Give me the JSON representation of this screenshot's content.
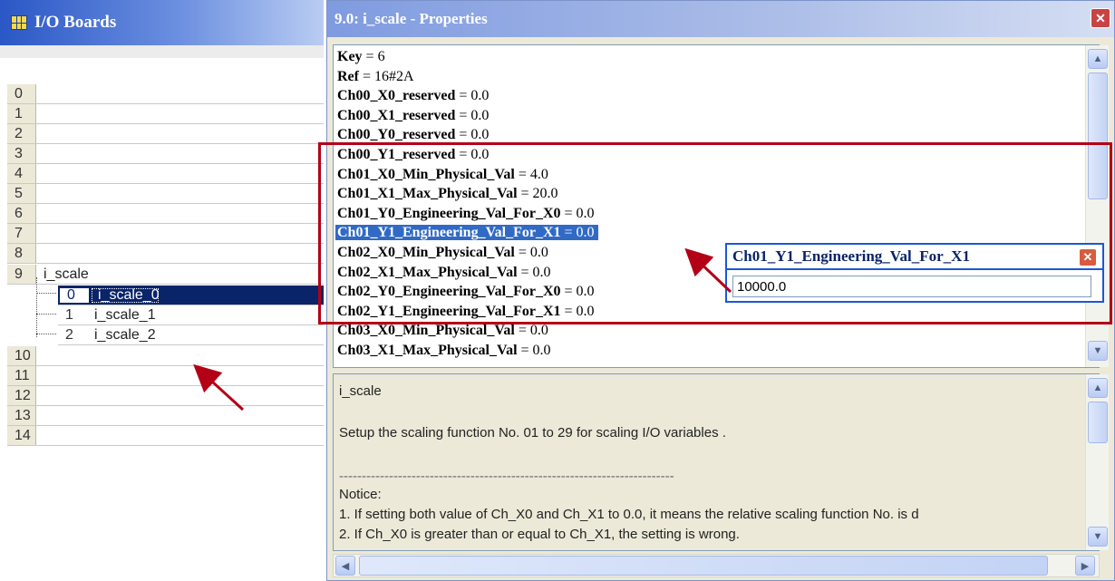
{
  "left_panel": {
    "title": "I/O Boards",
    "rows": [
      {
        "num": "0",
        "label": ""
      },
      {
        "num": "1",
        "label": ""
      },
      {
        "num": "2",
        "label": ""
      },
      {
        "num": "3",
        "label": ""
      },
      {
        "num": "4",
        "label": ""
      },
      {
        "num": "5",
        "label": ""
      },
      {
        "num": "6",
        "label": ""
      },
      {
        "num": "7",
        "label": ""
      },
      {
        "num": "8",
        "label": ""
      },
      {
        "num": "9",
        "label": "i_scale"
      },
      {
        "num": "0",
        "label": "i_scale_0"
      },
      {
        "num": "1",
        "label": "i_scale_1"
      },
      {
        "num": "2",
        "label": "i_scale_2"
      },
      {
        "num": "10",
        "label": ""
      },
      {
        "num": "11",
        "label": ""
      },
      {
        "num": "12",
        "label": ""
      },
      {
        "num": "13",
        "label": ""
      },
      {
        "num": "14",
        "label": ""
      }
    ]
  },
  "properties": {
    "title": "9.0: i_scale - Properties",
    "close_glyph": "✕",
    "rows": [
      {
        "key": "Key",
        "value": " = 6"
      },
      {
        "key": "Ref",
        "value": " = 16#2A"
      },
      {
        "key": "Ch00_X0_reserved",
        "value": " = 0.0"
      },
      {
        "key": "Ch00_X1_reserved",
        "value": " = 0.0"
      },
      {
        "key": "Ch00_Y0_reserved",
        "value": " = 0.0"
      },
      {
        "key": "Ch00_Y1_reserved",
        "value": " = 0.0"
      },
      {
        "key": "Ch01_X0_Min_Physical_Val",
        "value": " = 4.0"
      },
      {
        "key": "Ch01_X1_Max_Physical_Val",
        "value": " = 20.0"
      },
      {
        "key": "Ch01_Y0_Engineering_Val_For_X0",
        "value": " = 0.0"
      },
      {
        "key": "Ch01_Y1_Engineering_Val_For_X1",
        "value": " = 0.0"
      },
      {
        "key": "Ch02_X0_Min_Physical_Val",
        "value": " = 0.0"
      },
      {
        "key": "Ch02_X1_Max_Physical_Val",
        "value": " = 0.0"
      },
      {
        "key": "Ch02_Y0_Engineering_Val_For_X0",
        "value": " = 0.0"
      },
      {
        "key": "Ch02_Y1_Engineering_Val_For_X1",
        "value": " = 0.0"
      },
      {
        "key": "Ch03_X0_Min_Physical_Val",
        "value": " = 0.0"
      },
      {
        "key": "Ch03_X1_Max_Physical_Val",
        "value": " = 0.0"
      }
    ],
    "selected_row_index": 9
  },
  "description": {
    "heading": "i_scale",
    "summary": "Setup the scaling function No. 01 to 29 for scaling I/O variables .",
    "separator": "--------------------------------------------------------------------------",
    "notice_label": "Notice:",
    "notice_1": "1. If setting both value of Ch_X0 and Ch_X1 to 0.0, it means the relative scaling function No. is d",
    "notice_2": "2. If Ch_X0 is greater than or equal to Ch_X1, the setting is wrong."
  },
  "edit_popup": {
    "title": "Ch01_Y1_Engineering_Val_For_X1",
    "value": "10000.0",
    "close_glyph": "✕"
  },
  "colors": {
    "annotation_red": "#b30016",
    "selection_blue": "#316ac5",
    "tree_selection": "#0a246a"
  }
}
